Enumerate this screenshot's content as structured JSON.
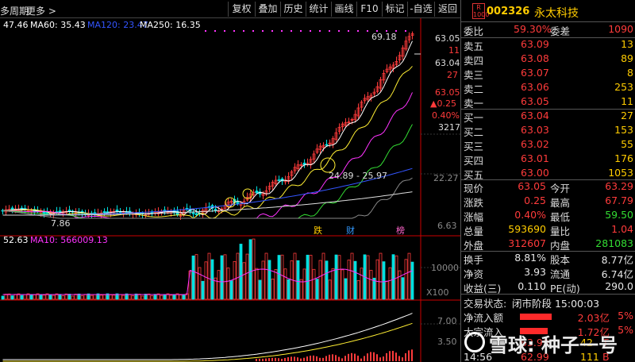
{
  "toolbar": {
    "period": "多周期",
    "more": "更多 >",
    "buttons": [
      "复权",
      "叠加",
      "历史",
      "统计",
      "画线",
      "F10",
      "标记",
      "-自选",
      "返回"
    ]
  },
  "legend_top": {
    "ma_first": "47.46",
    "ma60": "MA60: 35.43",
    "ma120": "MA120: 23.47",
    "ma250": "MA250: 16.35"
  },
  "legend_vol": {
    "first": "52.63",
    "ma10": "MA10: 566009.13"
  },
  "chart_labels": {
    "high_label": "69.18",
    "low_label": "7.86",
    "range_label": "24.89 - 25.97",
    "markers": [
      "跌",
      "财",
      "榜"
    ]
  },
  "price_axis": {
    "top_price": "63.05",
    "top_count": "11",
    "mid_price": "63.04",
    "mid_count": "27",
    "cur_price": "63.05",
    "cur_change": "▲0.25",
    "cur_pct": "0.40%",
    "cur_volume": "3217",
    "ticks": [
      "22.27",
      "6.63"
    ]
  },
  "volume_axis": {
    "tick": "10000",
    "unit": "X100"
  },
  "indicator_axis": {
    "ticks": [
      "7.00",
      "3.50"
    ]
  },
  "colors": {
    "up": "#ff3b3b",
    "down": "#00e0e0",
    "ma_white": "#ffffff",
    "ma_yellow": "#ffee33",
    "ma_magenta": "#ff33ff",
    "ma_green": "#33dd33",
    "ma120": "#3355ff",
    "ma250": "#dddddd"
  },
  "stock": {
    "logo": "R 1000",
    "code": "002326",
    "name": "永太科技"
  },
  "quote_top": {
    "weibi_label": "委比",
    "weibi": "59.30%",
    "weicha_label": "委差",
    "weicha": "1090"
  },
  "asks": [
    {
      "label": "卖五",
      "price": "63.09",
      "vol": "13"
    },
    {
      "label": "卖四",
      "price": "63.08",
      "vol": "89"
    },
    {
      "label": "卖三",
      "price": "63.07",
      "vol": "8"
    },
    {
      "label": "卖二",
      "price": "63.06",
      "vol": "253"
    },
    {
      "label": "卖一",
      "price": "63.05",
      "vol": "11"
    }
  ],
  "bids": [
    {
      "label": "买一",
      "price": "63.04",
      "vol": "27"
    },
    {
      "label": "买二",
      "price": "63.03",
      "vol": "153"
    },
    {
      "label": "买三",
      "price": "63.02",
      "vol": "55"
    },
    {
      "label": "买四",
      "price": "63.01",
      "vol": "176"
    },
    {
      "label": "买五",
      "price": "63.00",
      "vol": "1053"
    }
  ],
  "stats1": [
    {
      "l1": "现价",
      "v1": "63.05",
      "c1": "red",
      "l2": "今开",
      "v2": "63.29",
      "c2": "red"
    },
    {
      "l1": "涨跌",
      "v1": "0.25",
      "c1": "red",
      "l2": "最高",
      "v2": "67.79",
      "c2": "red"
    },
    {
      "l1": "涨幅",
      "v1": "0.40%",
      "c1": "red",
      "l2": "最低",
      "v2": "59.50",
      "c2": "green"
    },
    {
      "l1": "总量",
      "v1": "593690",
      "c1": "yellow",
      "l2": "量比",
      "v2": "1.04",
      "c2": "red"
    },
    {
      "l1": "外盘",
      "v1": "312607",
      "c1": "red",
      "l2": "内盘",
      "v2": "281083",
      "c2": "green"
    }
  ],
  "stats2": [
    {
      "l1": "换手",
      "v1": "8.81%",
      "c1": "white",
      "l2": "股本",
      "v2": "8.77亿",
      "c2": "white"
    },
    {
      "l1": "净资",
      "v1": "3.93",
      "c1": "white",
      "l2": "流通",
      "v2": "6.74亿",
      "c2": "white"
    },
    {
      "l1": "收益(三)",
      "v1": "0.110",
      "c1": "white",
      "l2": "PE(动)",
      "v2": "290.0",
      "c2": "white"
    }
  ],
  "trade_status": {
    "label": "交易状态:",
    "value": "闭市阶段 15:00:03"
  },
  "flows": [
    {
      "label": "净流入额",
      "value": "2.03亿",
      "pct": "5%",
      "bar": 0.9
    },
    {
      "label": "大宗流入",
      "value": "1.72亿",
      "pct": "5%",
      "bar": 0.8
    }
  ],
  "ticks_bottom": [
    {
      "time": "",
      "price": "63.99",
      "vol": "42",
      "flag": "T"
    },
    {
      "time": "14:56",
      "price": "62.99",
      "vol": "111",
      "flag": "B"
    }
  ],
  "watermark": "雪球: 种子一号"
}
